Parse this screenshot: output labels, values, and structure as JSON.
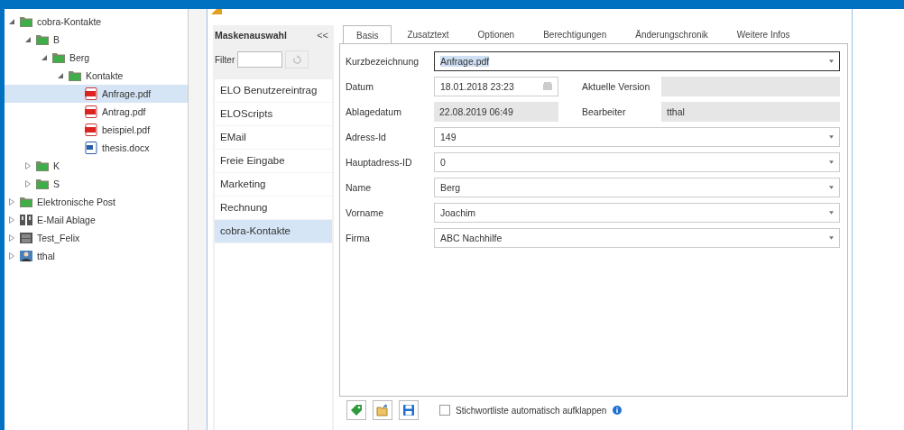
{
  "tree": [
    {
      "label": "cobra-Kontakte",
      "kind": "folder",
      "expanded": true,
      "selected": false,
      "children": [
        {
          "label": "B",
          "kind": "folder",
          "expanded": true,
          "selected": false,
          "children": [
            {
              "label": "Berg",
              "kind": "folder",
              "expanded": true,
              "selected": false,
              "children": [
                {
                  "label": "Kontakte",
                  "kind": "folder",
                  "expanded": true,
                  "selected": false,
                  "children": [
                    {
                      "label": "Anfrage.pdf",
                      "kind": "pdf",
                      "selected": true
                    },
                    {
                      "label": "Antrag.pdf",
                      "kind": "pdf",
                      "selected": false
                    },
                    {
                      "label": "beispiel.pdf",
                      "kind": "pdf",
                      "selected": false
                    },
                    {
                      "label": "thesis.docx",
                      "kind": "doc",
                      "selected": false
                    }
                  ]
                }
              ]
            }
          ]
        },
        {
          "label": "K",
          "kind": "folder",
          "expanded": false,
          "selected": false
        },
        {
          "label": "S",
          "kind": "folder",
          "expanded": false,
          "selected": false
        }
      ]
    },
    {
      "label": "Elektronische Post",
      "kind": "folder",
      "expanded": false,
      "selected": false
    },
    {
      "label": "E-Mail Ablage",
      "kind": "binder",
      "expanded": false,
      "selected": false
    },
    {
      "label": "Test_Felix",
      "kind": "cabinet",
      "expanded": false,
      "selected": false
    },
    {
      "label": "tthal",
      "kind": "user",
      "expanded": false,
      "selected": false
    }
  ],
  "mask_panel": {
    "title": "Maskenauswahl",
    "collapse": "<<",
    "filter_label": "Filter",
    "items": [
      {
        "label": "ELO Benutzereintrag",
        "selected": false
      },
      {
        "label": "ELOScripts",
        "selected": false
      },
      {
        "label": "EMail",
        "selected": false
      },
      {
        "label": "Freie Eingabe",
        "selected": false
      },
      {
        "label": "Marketing",
        "selected": false
      },
      {
        "label": "Rechnung",
        "selected": false
      },
      {
        "label": "cobra-Kontakte",
        "selected": true
      }
    ]
  },
  "tabs": [
    {
      "label": "Basis",
      "selected": true
    },
    {
      "label": "Zusatztext",
      "selected": false
    },
    {
      "label": "Optionen",
      "selected": false
    },
    {
      "label": "Berechtigungen",
      "selected": false
    },
    {
      "label": "Änderungschronik",
      "selected": false
    },
    {
      "label": "Weitere Infos",
      "selected": false
    }
  ],
  "rows": [
    {
      "fields": [
        {
          "label": "Kurzbezeichnung",
          "value": "Anfrage.pdf",
          "kind": "combo",
          "focused": true
        }
      ]
    },
    {
      "fields": [
        {
          "label": "Datum",
          "value": "18.01.2018 23:23",
          "kind": "date"
        },
        {
          "label": "Aktuelle Version",
          "kind": "readonly"
        }
      ]
    },
    {
      "fields": [
        {
          "label": "Ablagedatum",
          "value": "22.08.2019 06:49",
          "kind": "readonly"
        },
        {
          "label": "Bearbeiter",
          "value": "tthal",
          "kind": "readonly"
        }
      ]
    },
    {
      "fields": [
        {
          "label": "Adress-Id",
          "value": "149",
          "kind": "combo",
          "focused": false
        }
      ]
    },
    {
      "fields": [
        {
          "label": "Hauptadress-ID",
          "value": "0",
          "kind": "combo",
          "focused": false
        }
      ]
    },
    {
      "fields": [
        {
          "label": "Name",
          "value": "Berg",
          "kind": "combo",
          "focused": false
        }
      ]
    },
    {
      "fields": [
        {
          "label": "Vorname",
          "value": "Joachim",
          "kind": "combo",
          "focused": false
        }
      ]
    },
    {
      "fields": [
        {
          "label": "Firma",
          "value": "ABC Nachhilfe",
          "kind": "combo",
          "focused": false
        }
      ]
    }
  ],
  "footer": {
    "checkbox": {
      "label": "Stichwortliste automatisch aufklappen",
      "checked": false
    }
  }
}
